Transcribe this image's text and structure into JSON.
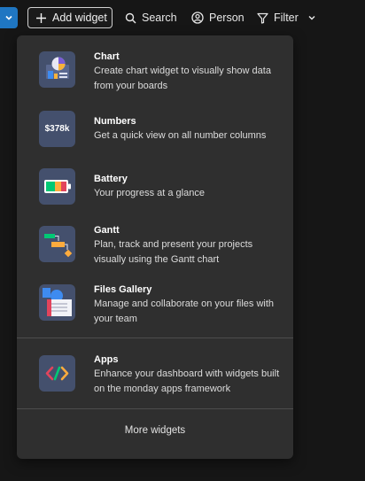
{
  "toolbar": {
    "add_widget_label": "Add widget",
    "search_label": "Search",
    "person_label": "Person",
    "filter_label": "Filter"
  },
  "menu": {
    "items": [
      {
        "title": "Chart",
        "description": "Create chart widget to visually show data from your boards",
        "icon": "chart-widget-icon"
      },
      {
        "title": "Numbers",
        "description": "Get a quick view on all number columns",
        "icon": "numbers-widget-icon",
        "icon_text": "$378k"
      },
      {
        "title": "Battery",
        "description": "Your progress at a glance",
        "icon": "battery-widget-icon"
      },
      {
        "title": "Gantt",
        "description": "Plan, track and present your projects visually using the Gantt chart",
        "icon": "gantt-widget-icon"
      },
      {
        "title": "Files Gallery",
        "description": "Manage and collaborate on your files with your team",
        "icon": "files-gallery-widget-icon"
      },
      {
        "title": "Apps",
        "description": "Enhance your dashboard with widgets built on the monday apps framework",
        "icon": "apps-widget-icon"
      }
    ],
    "more_label": "More widgets"
  },
  "colors": {
    "background": "#161616",
    "panel": "#2f2f2f",
    "icon_tile": "#44506d",
    "accent_blue": "#1f76c2"
  }
}
